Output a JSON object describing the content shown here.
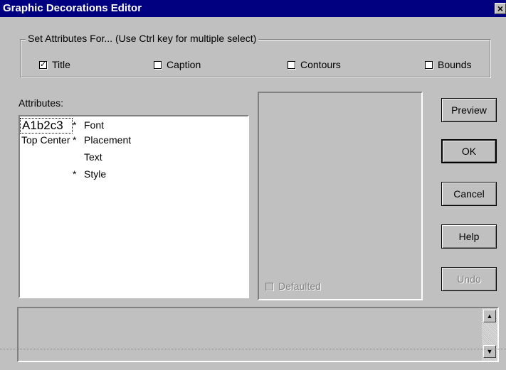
{
  "window": {
    "title": "Graphic Decorations Editor",
    "close_glyph": "×"
  },
  "group": {
    "legend": "Set Attributes For... (Use Ctrl key for multiple select)",
    "checkboxes": [
      {
        "label": "Title",
        "checked": true
      },
      {
        "label": "Caption",
        "checked": false
      },
      {
        "label": "Contours",
        "checked": false
      },
      {
        "label": "Bounds",
        "checked": false
      }
    ]
  },
  "attributes": {
    "label": "Attributes:",
    "rows": [
      {
        "value": "A1b2c3",
        "marker": "*",
        "name": "Font"
      },
      {
        "value": "Top Center",
        "marker": "*",
        "name": "Placement"
      },
      {
        "value": "",
        "marker": "",
        "name": "Text"
      },
      {
        "value": "",
        "marker": "*",
        "name": "Style"
      }
    ]
  },
  "preview_pane": {
    "defaulted_label": "Defaulted",
    "defaulted_checked": false
  },
  "buttons": {
    "preview": "Preview",
    "ok": "OK",
    "cancel": "Cancel",
    "help": "Help",
    "undo": "Undo"
  },
  "icons": {
    "scroll_up": "scroll-up-arrow-icon",
    "scroll_down": "scroll-down-arrow-icon",
    "check": "checkmark-icon"
  },
  "colors": {
    "titlebar": "#000080",
    "face": "#c0c0c0"
  }
}
